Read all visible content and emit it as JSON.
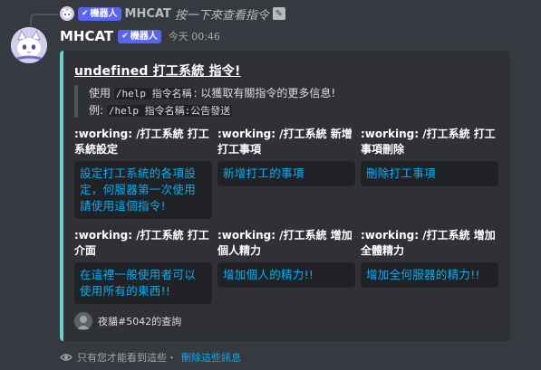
{
  "reply": {
    "bot_tag": "機器人",
    "username": "MHCAT",
    "text": "按一下來查看指令"
  },
  "message": {
    "username": "MHCAT",
    "bot_tag": "機器人",
    "timestamp": "今天 00:46"
  },
  "embed": {
    "accent_color": "#66d1c9",
    "title": "undefined 打工系統 指令!",
    "desc_line1_prefix": "使用 ",
    "desc_line1_code": "/help 指令名稱",
    "desc_line1_suffix": ": 以獲取有關指令的更多信息!",
    "desc_line2_prefix": "例: ",
    "desc_line2_code": "/help 指令名稱:公告發送",
    "fields": [
      {
        "name": ":working: /打工系統 打工系統設定",
        "value": "設定打工系統的各項設定，何服器第一次使用請使用這個指令!"
      },
      {
        "name": ":working: /打工系統 新增打工事項",
        "value": "新增打工的事項"
      },
      {
        "name": ":working: /打工系統 打工事項刪除",
        "value": "刪除打工事項"
      },
      {
        "name": ":working: /打工系統 打工介面",
        "value": "在這裡一般使用者可以使用所有的東西!!"
      },
      {
        "name": ":working: /打工系統 增加個人精力",
        "value": "增加個人的精力!!"
      },
      {
        "name": ":working: /打工系統 增加全體精力",
        "value": "增加全何服器的精力!!"
      }
    ],
    "footer": "夜貓#5042的查詢"
  },
  "ephemeral": {
    "text": "只有您才能看到這些・",
    "link": "刪除這些訊息"
  },
  "colors": {
    "background": "#36393f",
    "embed_bg": "#2f3136",
    "code_bg": "#202225",
    "field_value": "#00b0f4",
    "bot_tag": "#5865f2"
  },
  "icons": [
    "cat-avatar",
    "checkmark-icon",
    "slash-command-icon",
    "eye-icon"
  ]
}
